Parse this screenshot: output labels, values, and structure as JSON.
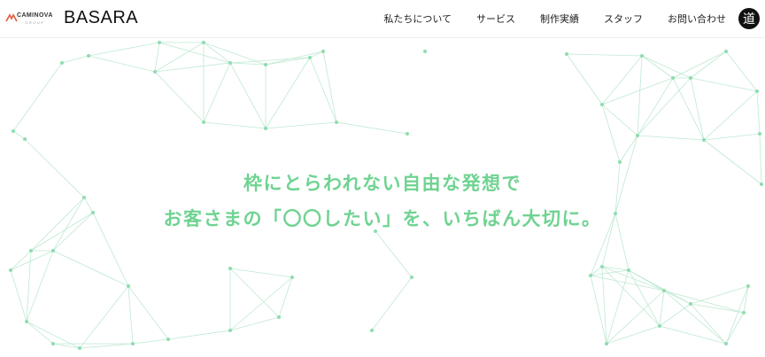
{
  "header": {
    "parent_brand": "CAMINOVA",
    "parent_brand_sub": "GROUP",
    "brand": "BASARA",
    "nav": [
      {
        "label": "私たちについて"
      },
      {
        "label": "サービス"
      },
      {
        "label": "制作実績"
      },
      {
        "label": "スタッフ"
      },
      {
        "label": "お問い合わせ"
      }
    ],
    "seal_glyph": "道"
  },
  "hero": {
    "line1": "枠にとらわれない自由な発想で",
    "line2": "お客さまの「〇〇したい」を、いちばん大切に。"
  },
  "colors": {
    "accent": "#6fd391",
    "network_line": "#bfe9d2",
    "network_dot": "#8fdcb0"
  }
}
